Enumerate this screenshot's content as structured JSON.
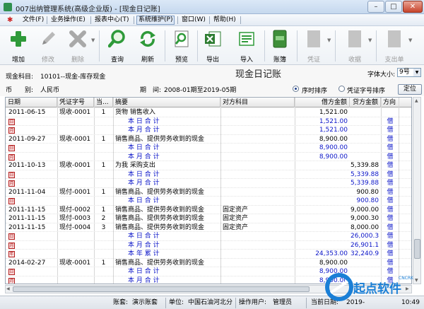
{
  "window": {
    "title": "007出纳管理系统(高级企业版) - [现金日记账]",
    "min": "–",
    "max": "□",
    "close": "✕"
  },
  "menu": [
    "文件(F)",
    "业务操作(E)",
    "报表中心(T)",
    "系统维护(P)",
    "窗口(W)",
    "帮助(H)"
  ],
  "toolbar": [
    {
      "label": "增加",
      "icon": "plus-icon",
      "enabled": true
    },
    {
      "label": "修改",
      "icon": "pencil-icon",
      "enabled": false
    },
    {
      "label": "删除",
      "icon": "delete-x-icon",
      "enabled": false
    },
    {
      "label": "查询",
      "icon": "magnifier-icon",
      "enabled": true
    },
    {
      "label": "刷新",
      "icon": "refresh-icon",
      "enabled": true
    },
    {
      "label": "预览",
      "icon": "preview-icon",
      "enabled": true
    },
    {
      "label": "导出",
      "icon": "excel-icon",
      "enabled": true
    },
    {
      "label": "导入",
      "icon": "import-icon",
      "enabled": true
    },
    {
      "label": "账簿",
      "icon": "ledger-book-icon",
      "enabled": true
    },
    {
      "label": "凭证",
      "icon": "voucher-icon",
      "enabled": false
    },
    {
      "label": "收据",
      "icon": "receipt-icon",
      "enabled": false
    },
    {
      "label": "支出单",
      "icon": "payment-slip-icon",
      "enabled": false
    }
  ],
  "colors": {
    "accent_green": "#2f9a3a",
    "amount_blue": "#0a14c8",
    "marker_red": "#b21b1b"
  },
  "header": {
    "account_label": "现金科目:",
    "account_value": "10101--现金-库存现金",
    "currency_label": "币　　别:",
    "currency_value": "人民币",
    "period_label": "期　间:",
    "period_value": "2008-01期至2019-05期",
    "report_title": "现金日记账",
    "font_size_label": "字体大小:",
    "font_size_value": "9号",
    "sort_time": "序时排序",
    "sort_voucher": "凭证字号排序",
    "locate": "定位"
  },
  "columns": [
    "日期",
    "凭证字号",
    "当...",
    "摘要",
    "对方科目",
    "借方金额",
    "贷方金额",
    "方向"
  ],
  "rows": [
    {
      "date": "2011-06-15",
      "voucher": "现收-0001",
      "no": "1",
      "summary": "货物 销售收入",
      "opp": "",
      "debit": "1,521.00",
      "credit": "",
      "dir": "",
      "type": "normal",
      "mark": ""
    },
    {
      "date": "",
      "voucher": "",
      "no": "",
      "summary": "本 日 合 计",
      "opp": "",
      "debit": "1,521.00",
      "credit": "",
      "dir": "借",
      "type": "sum",
      "mark": "日"
    },
    {
      "date": "",
      "voucher": "",
      "no": "",
      "summary": "本 月 合 计",
      "opp": "",
      "debit": "1,521.00",
      "credit": "",
      "dir": "借",
      "type": "sum",
      "mark": "月"
    },
    {
      "date": "2011-09-27",
      "voucher": "现收-0001",
      "no": "1",
      "summary": "销售商品、提供劳务收到的现金",
      "opp": "",
      "debit": "8,900.00",
      "credit": "",
      "dir": "借",
      "type": "normal",
      "mark": ""
    },
    {
      "date": "",
      "voucher": "",
      "no": "",
      "summary": "本 日 合 计",
      "opp": "",
      "debit": "8,900.00",
      "credit": "",
      "dir": "借",
      "type": "sum",
      "mark": "日"
    },
    {
      "date": "",
      "voucher": "",
      "no": "",
      "summary": "本 月 合 计",
      "opp": "",
      "debit": "8,900.00",
      "credit": "",
      "dir": "借",
      "type": "sum",
      "mark": "月"
    },
    {
      "date": "2011-10-13",
      "voucher": "现收-0001",
      "no": "1",
      "summary": "为我 采购支出",
      "opp": "",
      "debit": "",
      "credit": "5,339.88",
      "dir": "借",
      "type": "normal",
      "mark": ""
    },
    {
      "date": "",
      "voucher": "",
      "no": "",
      "summary": "本 日 合 计",
      "opp": "",
      "debit": "",
      "credit": "5,339.88",
      "dir": "借",
      "type": "sum",
      "mark": "日"
    },
    {
      "date": "",
      "voucher": "",
      "no": "",
      "summary": "本 月 合 计",
      "opp": "",
      "debit": "",
      "credit": "5,339.88",
      "dir": "借",
      "type": "sum",
      "mark": "月"
    },
    {
      "date": "2011-11-04",
      "voucher": "现付-0001",
      "no": "1",
      "summary": "销售商品、提供劳务收到的现金",
      "opp": "",
      "debit": "",
      "credit": "900.80",
      "dir": "借",
      "type": "normal",
      "mark": ""
    },
    {
      "date": "",
      "voucher": "",
      "no": "",
      "summary": "本 日 合 计",
      "opp": "",
      "debit": "",
      "credit": "900.80",
      "dir": "借",
      "type": "sum",
      "mark": "日"
    },
    {
      "date": "2011-11-15",
      "voucher": "现付-0002",
      "no": "1",
      "summary": "销售商品、提供劳务收到的现金",
      "opp": "固定资产",
      "debit": "",
      "credit": "9,000.00",
      "dir": "借",
      "type": "normal",
      "mark": ""
    },
    {
      "date": "2011-11-15",
      "voucher": "现付-0003",
      "no": "2",
      "summary": "销售商品、提供劳务收到的现金",
      "opp": "固定资产",
      "debit": "",
      "credit": "9,000.30",
      "dir": "借",
      "type": "normal",
      "mark": ""
    },
    {
      "date": "2011-11-15",
      "voucher": "现付-0004",
      "no": "3",
      "summary": "销售商品、提供劳务收到的现金",
      "opp": "固定资产",
      "debit": "",
      "credit": "8,000.00",
      "dir": "借",
      "type": "normal",
      "mark": ""
    },
    {
      "date": "",
      "voucher": "",
      "no": "",
      "summary": "本 日 合 计",
      "opp": "",
      "debit": "",
      "credit": "26,000.30",
      "dir": "借",
      "type": "sum",
      "mark": "日"
    },
    {
      "date": "",
      "voucher": "",
      "no": "",
      "summary": "本 月 合 计",
      "opp": "",
      "debit": "",
      "credit": "26,901.10",
      "dir": "借",
      "type": "sum",
      "mark": "月"
    },
    {
      "date": "",
      "voucher": "",
      "no": "",
      "summary": "本 年 累 计",
      "opp": "",
      "debit": "24,353.00",
      "credit": "32,240.98",
      "dir": "借",
      "type": "sum",
      "mark": "年"
    },
    {
      "date": "2014-02-27",
      "voucher": "现收-0001",
      "no": "1",
      "summary": "销售商品、提供劳务收到的现金",
      "opp": "",
      "debit": "8,900.00",
      "credit": "",
      "dir": "借",
      "type": "normal",
      "mark": ""
    },
    {
      "date": "",
      "voucher": "",
      "no": "",
      "summary": "本 日 合 计",
      "opp": "",
      "debit": "8,900.00",
      "credit": "",
      "dir": "借",
      "type": "sum",
      "mark": "日"
    },
    {
      "date": "",
      "voucher": "",
      "no": "",
      "summary": "本 月 合 计",
      "opp": "",
      "debit": "8,900.00",
      "credit": "",
      "dir": "借",
      "type": "sum",
      "mark": "月"
    }
  ],
  "status": {
    "book_label": "账套:",
    "book_value": "演示账套",
    "unit_label": "单位:",
    "unit_value": "中国石油河北分",
    "user_label": "操作用户:",
    "user_value": "管理员",
    "date_label": "当前日期:",
    "date_value": "2019-",
    "time_value": "10:49"
  },
  "watermark": {
    "brand": "起点软件",
    "site": "CNCRK"
  }
}
